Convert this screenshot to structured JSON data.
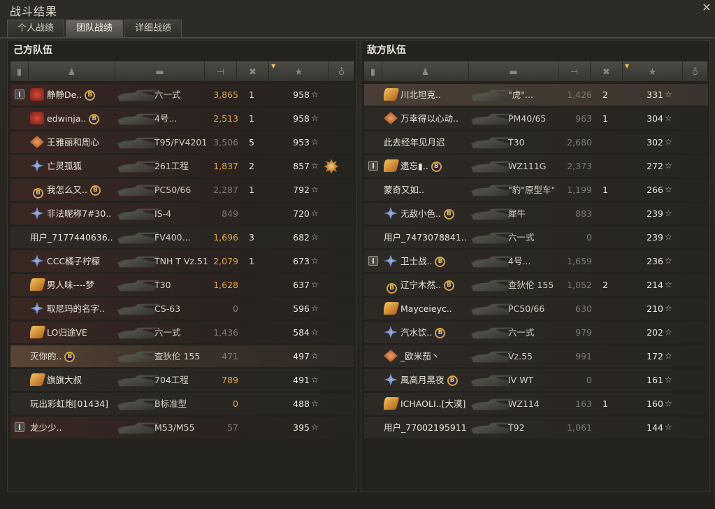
{
  "window": {
    "title": "战斗结果",
    "close_icon": "close-icon"
  },
  "tabs": [
    {
      "label": "个人战绩",
      "active": false
    },
    {
      "label": "团队战绩",
      "active": true
    },
    {
      "label": "详细战绩",
      "active": false
    }
  ],
  "columns": [
    "platoon",
    "player",
    "tank",
    "damage",
    "kills",
    "xp",
    "medal"
  ],
  "allies": {
    "title": "己方队伍",
    "rows": [
      {
        "platoon": true,
        "badge": "red",
        "name": "静静De..",
        "coin": true,
        "tank": "六一式",
        "damage": "3,865",
        "dmg_active": true,
        "kills": "1",
        "xp": "958",
        "medal": false,
        "style": "red"
      },
      {
        "platoon": false,
        "badge": "red",
        "name": "edwinja..",
        "coin": true,
        "tank": "4号...",
        "damage": "2,513",
        "dmg_active": true,
        "kills": "1",
        "xp": "958",
        "medal": false,
        "style": "red"
      },
      {
        "platoon": false,
        "badge": "orange",
        "name": "王雅丽和周心",
        "coin": false,
        "tank": "T95/FV4201",
        "damage": "3,506",
        "dmg_active": false,
        "kills": "5",
        "xp": "953",
        "medal": false,
        "style": "red"
      },
      {
        "platoon": false,
        "badge": "blue",
        "name": "亡灵孤狐",
        "coin": false,
        "tank": "261工程",
        "damage": "1,837",
        "dmg_active": true,
        "kills": "2",
        "xp": "857",
        "medal": true,
        "style": "red"
      },
      {
        "platoon": false,
        "badge": "coin",
        "name": "我怎么又..",
        "coin": true,
        "tank": "PC50/66",
        "damage": "2,287",
        "dmg_active": false,
        "kills": "1",
        "xp": "792",
        "medal": false,
        "style": "red"
      },
      {
        "platoon": false,
        "badge": "blue",
        "name": "非法昵称7#30..",
        "coin": false,
        "tank": "IS-4",
        "damage": "849",
        "dmg_active": false,
        "kills": "",
        "xp": "720",
        "medal": false,
        "style": "red"
      },
      {
        "platoon": false,
        "badge": "",
        "name": "用户_7177440636..",
        "coin": false,
        "tank": "FV400...",
        "damage": "1,696",
        "dmg_active": true,
        "kills": "3",
        "xp": "682",
        "medal": false,
        "style": "plain"
      },
      {
        "platoon": false,
        "badge": "blue",
        "name": "CCC橘子柠檬",
        "coin": false,
        "tank": "TNH T Vz.51",
        "damage": "2,079",
        "dmg_active": true,
        "kills": "1",
        "xp": "673",
        "medal": false,
        "style": "red"
      },
      {
        "platoon": false,
        "badge": "gold",
        "name": "男人味----梦",
        "coin": false,
        "tank": "T30",
        "damage": "1,628",
        "dmg_active": true,
        "kills": "",
        "xp": "637",
        "medal": false,
        "style": "red"
      },
      {
        "platoon": false,
        "badge": "blue",
        "name": "取尼玛的名字..",
        "coin": false,
        "tank": "CS-63",
        "damage": "0",
        "dmg_active": false,
        "kills": "",
        "xp": "596",
        "medal": false,
        "style": "red"
      },
      {
        "platoon": false,
        "badge": "gold",
        "name": "LO归途VE",
        "coin": false,
        "tank": "六一式",
        "damage": "1,436",
        "dmg_active": false,
        "kills": "",
        "xp": "584",
        "medal": false,
        "style": "red"
      },
      {
        "platoon": false,
        "badge": "",
        "name": "灭你的..",
        "coin": true,
        "tank": "查狄伦 155",
        "damage": "471",
        "dmg_active": false,
        "kills": "",
        "xp": "497",
        "medal": false,
        "style": "hl"
      },
      {
        "platoon": false,
        "badge": "gold",
        "name": "旗旗大叔",
        "coin": false,
        "tank": "704工程",
        "damage": "789",
        "dmg_active": true,
        "kills": "",
        "xp": "491",
        "medal": false,
        "style": "plain"
      },
      {
        "platoon": false,
        "badge": "",
        "name": "玩出彩虹炮[01434]",
        "coin": false,
        "tank": "B标准型",
        "damage": "0",
        "dmg_active": true,
        "kills": "",
        "xp": "488",
        "medal": false,
        "style": "plain"
      },
      {
        "platoon": true,
        "badge": "",
        "name": "龙少少..",
        "coin": false,
        "tank": "M53/M55",
        "damage": "57",
        "dmg_active": false,
        "kills": "",
        "xp": "395",
        "medal": false,
        "style": "red"
      }
    ]
  },
  "enemies": {
    "title": "敌方队伍",
    "rows": [
      {
        "platoon": false,
        "badge": "gold",
        "name": "川北坦克..",
        "coin": false,
        "tank": "\"虎\"...",
        "damage": "1,426",
        "dmg_active": false,
        "kills": "2",
        "xp": "331",
        "medal": false,
        "style": "self"
      },
      {
        "platoon": false,
        "badge": "orange",
        "name": "万幸得以心动..",
        "coin": false,
        "tank": "PM40/65",
        "damage": "963",
        "dmg_active": false,
        "kills": "1",
        "xp": "304",
        "medal": false,
        "style": "plain"
      },
      {
        "platoon": false,
        "badge": "",
        "name": "此去经年见月迟",
        "coin": false,
        "tank": "T30",
        "damage": "2,680",
        "dmg_active": false,
        "kills": "",
        "xp": "302",
        "medal": false,
        "style": "plain"
      },
      {
        "platoon": true,
        "badge": "gold",
        "name": "遗忘▮..",
        "coin": true,
        "tank": "WZ111G",
        "damage": "2,373",
        "dmg_active": false,
        "kills": "",
        "xp": "272",
        "medal": false,
        "style": "plain"
      },
      {
        "platoon": false,
        "badge": "",
        "name": "蒙奇又如..",
        "coin": false,
        "tank": "\"豹\"原型车\"",
        "damage": "1,199",
        "dmg_active": false,
        "kills": "1",
        "xp": "266",
        "medal": false,
        "style": "plain"
      },
      {
        "platoon": false,
        "badge": "blue",
        "name": "无敌小色..",
        "coin": true,
        "tank": "犀牛",
        "damage": "883",
        "dmg_active": false,
        "kills": "",
        "xp": "239",
        "medal": false,
        "style": "plain"
      },
      {
        "platoon": false,
        "badge": "",
        "name": "用户_7473078841..",
        "coin": false,
        "tank": "六一式",
        "damage": "0",
        "dmg_active": false,
        "kills": "",
        "xp": "239",
        "medal": false,
        "style": "plain"
      },
      {
        "platoon": true,
        "badge": "blue",
        "name": "卫士战..",
        "coin": true,
        "tank": "4号...",
        "damage": "1,659",
        "dmg_active": false,
        "kills": "",
        "xp": "236",
        "medal": false,
        "style": "plain"
      },
      {
        "platoon": false,
        "badge": "coin",
        "name": "辽宁木然..",
        "coin": true,
        "tank": "查狄伦 155",
        "damage": "1,052",
        "dmg_active": false,
        "kills": "2",
        "xp": "214",
        "medal": false,
        "style": "plain"
      },
      {
        "platoon": false,
        "badge": "gold",
        "name": "Mayceieyc..",
        "coin": false,
        "tank": "PC50/66",
        "damage": "630",
        "dmg_active": false,
        "kills": "",
        "xp": "210",
        "medal": false,
        "style": "plain"
      },
      {
        "platoon": false,
        "badge": "blue",
        "name": "汽水饮..",
        "coin": true,
        "tank": "六一式",
        "damage": "979",
        "dmg_active": false,
        "kills": "",
        "xp": "202",
        "medal": false,
        "style": "plain"
      },
      {
        "platoon": false,
        "badge": "orange",
        "name": "_欧米茄丶",
        "coin": false,
        "tank": "Vz.55",
        "damage": "991",
        "dmg_active": false,
        "kills": "",
        "xp": "172",
        "medal": false,
        "style": "plain"
      },
      {
        "platoon": false,
        "badge": "blue",
        "name": "風高月黑夜",
        "coin": true,
        "tank": "IV WT",
        "damage": "0",
        "dmg_active": false,
        "kills": "",
        "xp": "161",
        "medal": false,
        "style": "plain"
      },
      {
        "platoon": false,
        "badge": "gold",
        "name": "ICHAOLI..[大漠]",
        "coin": false,
        "tank": "WZ114",
        "damage": "163",
        "dmg_active": false,
        "kills": "1",
        "xp": "160",
        "medal": false,
        "style": "plain"
      },
      {
        "platoon": false,
        "badge": "",
        "name": "用户_77002195911",
        "coin": false,
        "tank": "T92",
        "damage": "1,061",
        "dmg_active": false,
        "kills": "",
        "xp": "144",
        "medal": false,
        "style": "plain"
      }
    ]
  },
  "star_glyph": "☆",
  "coin_glyph": "B",
  "sort_glyph": "▼",
  "close_glyph": "✕"
}
